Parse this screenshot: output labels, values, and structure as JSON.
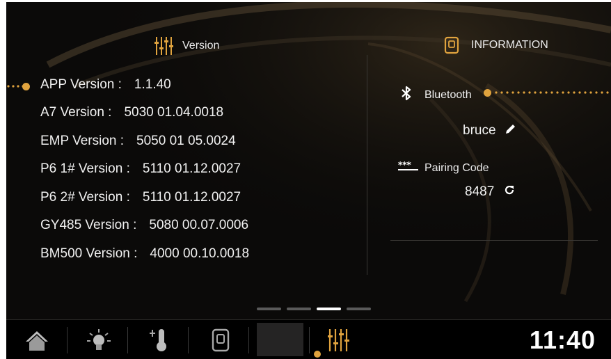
{
  "version_panel": {
    "title": "Version",
    "rows": [
      {
        "label": "APP Version :",
        "value": "1.1.40"
      },
      {
        "label": "A7 Version :",
        "value": "5030 01.04.0018"
      },
      {
        "label": "EMP Version :",
        "value": "5050 01 05.0024"
      },
      {
        "label": "P6 1# Version :",
        "value": "5110 01.12.0027"
      },
      {
        "label": "P6 2# Version :",
        "value": "5110 01.12.0027"
      },
      {
        "label": "GY485 Version :",
        "value": "5080 00.07.0006"
      },
      {
        "label": "BM500 Version :",
        "value": "4000 00.10.0018"
      }
    ]
  },
  "info_panel": {
    "title": "INFORMATION",
    "bluetooth_label": "Bluetooth",
    "device_name": "bruce",
    "pairing_label": "Pairing Code",
    "pairing_code": "8487"
  },
  "pager": {
    "pages": 4,
    "active_index": 2
  },
  "bottom_nav": {
    "items": [
      "home-icon",
      "light-icon",
      "thermometer-icon",
      "device-icon",
      "blank",
      "equalizer-icon"
    ],
    "active_index": 5,
    "clock": "11:40"
  },
  "colors": {
    "accent": "#e0a33e",
    "background": "#0b0a09",
    "text": "#f1f1f1"
  }
}
